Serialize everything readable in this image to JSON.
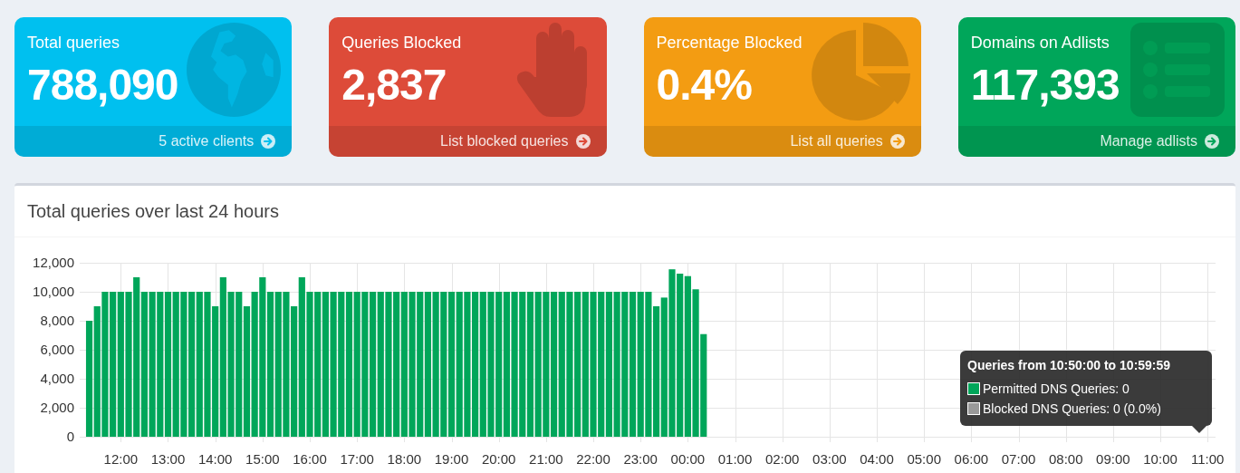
{
  "cards": [
    {
      "title": "Total queries",
      "value": "788,090",
      "footer": "5 active clients",
      "color": "#00c0ef"
    },
    {
      "title": "Queries Blocked",
      "value": "2,837",
      "footer": "List blocked queries",
      "color": "#dd4b39"
    },
    {
      "title": "Percentage Blocked",
      "value": "0.4%",
      "footer": "List all queries",
      "color": "#f39c12"
    },
    {
      "title": "Domains on Adlists",
      "value": "117,393",
      "footer": "Manage adlists",
      "color": "#00a65a"
    }
  ],
  "chart_panel": {
    "title": "Total queries over last 24 hours",
    "chart_data": {
      "type": "bar",
      "grid": true,
      "categories": [
        null,
        null,
        null,
        null,
        "12:00",
        null,
        null,
        null,
        null,
        null,
        "13:00",
        null,
        null,
        null,
        null,
        null,
        "14:00",
        null,
        null,
        null,
        null,
        null,
        "15:00",
        null,
        null,
        null,
        null,
        null,
        "16:00",
        null,
        null,
        null,
        null,
        null,
        "17:00",
        null,
        null,
        null,
        null,
        null,
        "18:00",
        null,
        null,
        null,
        null,
        null,
        "19:00",
        null,
        null,
        null,
        null,
        null,
        "20:00",
        null,
        null,
        null,
        null,
        null,
        "21:00",
        null,
        null,
        null,
        null,
        null,
        "22:00",
        null,
        null,
        null,
        null,
        null,
        "23:00",
        null,
        null,
        null,
        null,
        null,
        "00:00",
        null,
        null,
        null,
        null,
        null,
        "01:00",
        null,
        null,
        null,
        null,
        null,
        "02:00",
        null,
        null,
        null,
        null,
        null,
        "03:00",
        null,
        null,
        null,
        null,
        null,
        "04:00",
        null,
        null,
        null,
        null,
        null,
        "05:00",
        null,
        null,
        null,
        null,
        null,
        "06:00",
        null,
        null,
        null,
        null,
        null,
        "07:00",
        null,
        null,
        null,
        null,
        null,
        "08:00",
        null,
        null,
        null,
        null,
        null,
        "09:00",
        null,
        null,
        null,
        null,
        null,
        "10:00",
        null,
        null,
        null,
        null,
        null,
        "11:00",
        null
      ],
      "ylim": [
        0,
        12000
      ],
      "yticks": [
        {
          "value": 0,
          "label": "0"
        },
        {
          "value": 2000,
          "label": "2,000"
        },
        {
          "value": 4000,
          "label": "4,000"
        },
        {
          "value": 6000,
          "label": "6,000"
        },
        {
          "value": 8000,
          "label": "8,000"
        },
        {
          "value": 10000,
          "label": "10,000"
        },
        {
          "value": 12000,
          "label": "12,000"
        }
      ],
      "series": [
        {
          "color": "#00a65a",
          "values": [
            8000,
            9000,
            10000,
            10000,
            10000,
            10000,
            11000,
            10000,
            10000,
            10000,
            10000,
            10000,
            10000,
            10000,
            10000,
            10000,
            9000,
            11000,
            10000,
            10000,
            9000,
            10000,
            11000,
            10000,
            10000,
            10000,
            9000,
            11000,
            10000,
            10000,
            10000,
            10000,
            10000,
            10000,
            10000,
            10000,
            10000,
            10000,
            10000,
            10000,
            10000,
            10000,
            10000,
            10000,
            10000,
            10000,
            10000,
            10000,
            10000,
            10000,
            10000,
            10000,
            10000,
            10000,
            10000,
            10000,
            10000,
            10000,
            10000,
            10000,
            10000,
            10000,
            10000,
            10000,
            10000,
            10000,
            10000,
            10000,
            10000,
            10000,
            10000,
            10000,
            9000,
            9600,
            11550,
            11250,
            11080,
            10170,
            7080,
            0,
            0,
            0,
            0,
            0,
            0,
            0,
            0,
            0,
            0,
            0,
            0,
            0,
            0,
            0,
            0,
            0,
            0,
            0,
            0,
            0,
            0,
            0,
            0,
            0,
            0,
            0,
            0,
            0,
            0,
            0,
            0,
            0,
            0,
            0,
            0,
            0,
            0,
            0,
            0,
            0,
            0,
            0,
            0,
            0,
            0,
            0,
            0,
            0,
            0,
            0,
            0,
            0,
            0,
            0,
            0,
            0,
            0,
            0,
            0,
            0,
            0,
            0,
            0,
            0
          ]
        }
      ]
    },
    "tooltip": {
      "title": "Queries from 10:50:00 to 10:59:59",
      "items": [
        {
          "label": "Permitted DNS Queries: 0",
          "color": "#00a65a"
        },
        {
          "label": "Blocked DNS Queries: 0 (0.0%)",
          "color": "#999999"
        }
      ]
    }
  }
}
